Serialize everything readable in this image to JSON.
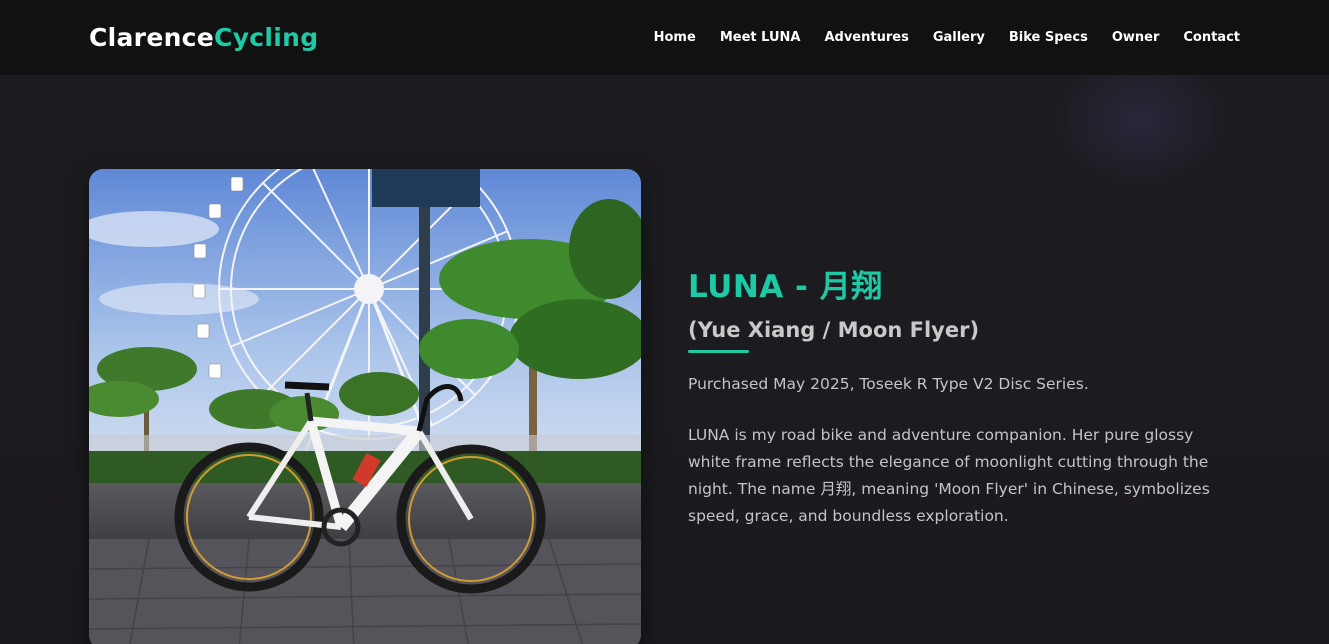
{
  "brand": {
    "first": "Clarence",
    "second": "Cycling"
  },
  "nav": {
    "items": [
      {
        "label": "Home"
      },
      {
        "label": "Meet LUNA"
      },
      {
        "label": "Adventures"
      },
      {
        "label": "Gallery"
      },
      {
        "label": "Bike Specs"
      },
      {
        "label": "Owner"
      },
      {
        "label": "Contact"
      }
    ]
  },
  "hero": {
    "title": "LUNA - 月翔",
    "subtitle": "(Yue Xiang / Moon Flyer)",
    "purchased": "Purchased May 2025, Toseek R Type V2 Disc Series.",
    "description": "LUNA is my road bike and adventure companion. Her pure glossy white frame reflects the elegance of moonlight cutting through the night. The name 月翔, meaning 'Moon Flyer' in Chinese, symbolizes speed, grace, and boundless exploration."
  },
  "colors": {
    "accent": "#1ec9a6",
    "background": "#1c1b1f",
    "navbar": "#111111",
    "text_muted": "#c4c4c8"
  }
}
